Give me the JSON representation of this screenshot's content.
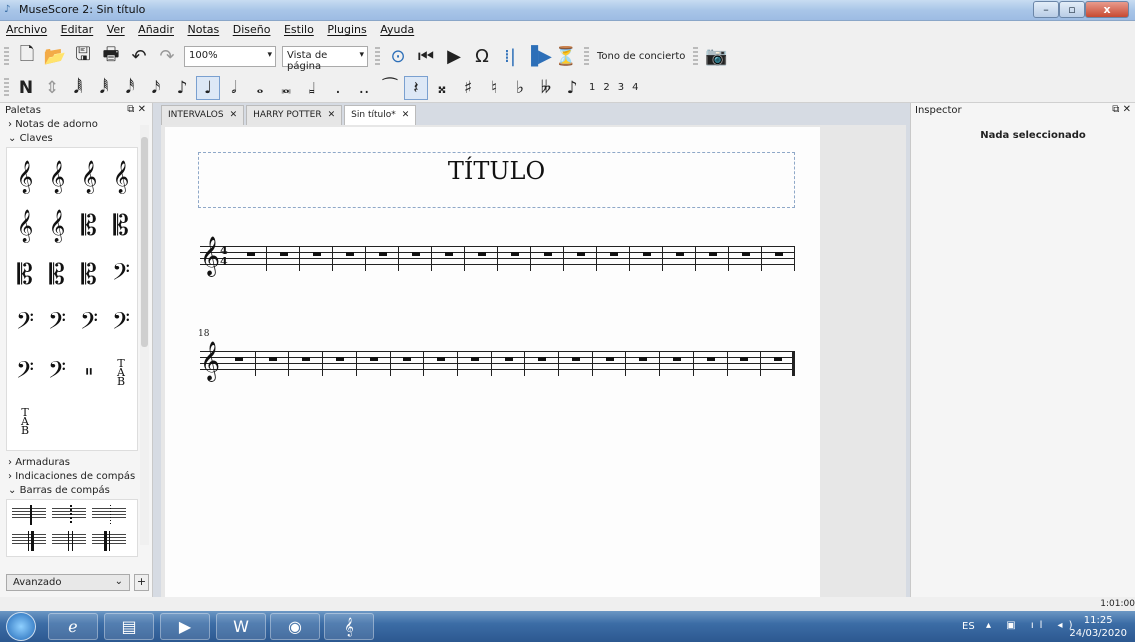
{
  "window": {
    "title": "MuseScore 2: Sin título"
  },
  "menu": [
    "Archivo",
    "Editar",
    "Ver",
    "Añadir",
    "Notas",
    "Diseño",
    "Estilo",
    "Plugins",
    "Ayuda"
  ],
  "toolbar1": {
    "zoom": "100%",
    "view_mode": "Vista de página",
    "concert_pitch": "Tono de concierto"
  },
  "toolbar2": {
    "voices": [
      "1",
      "2",
      "3",
      "4"
    ]
  },
  "palette": {
    "title": "Paletas",
    "sections": {
      "grace_notes": "Notas de adorno",
      "clefs": "Claves",
      "key_signatures": "Armaduras",
      "time_signatures": "Indicaciones de compás",
      "barlines": "Barras de compás"
    },
    "workspace": "Avanzado"
  },
  "tabs": [
    {
      "label": "INTERVALOS"
    },
    {
      "label": "HARRY POTTER"
    },
    {
      "label": "Sin título*"
    }
  ],
  "score": {
    "title": "TÍTULO",
    "time_signature_top": "4",
    "time_signature_bottom": "4",
    "system2_measure_number": "18"
  },
  "inspector": {
    "title": "Inspector",
    "empty": "Nada seleccionado"
  },
  "status": {
    "time": "1:01:00"
  },
  "taskbar": {
    "lang": "ES",
    "clock_time": "11:25",
    "clock_date": "24/03/2020"
  }
}
